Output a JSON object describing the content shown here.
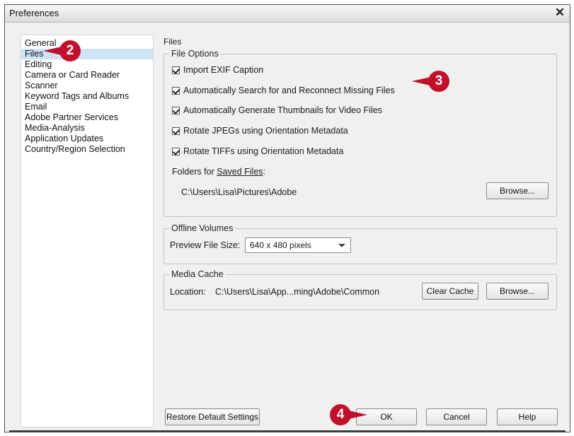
{
  "window": {
    "title": "Preferences",
    "close_glyph": "✕"
  },
  "sidebar": {
    "items": [
      {
        "label": "General"
      },
      {
        "label": "Files",
        "selected": true
      },
      {
        "label": "Editing"
      },
      {
        "label": "Camera or Card Reader"
      },
      {
        "label": "Scanner"
      },
      {
        "label": "Keyword Tags and Albums"
      },
      {
        "label": "Email"
      },
      {
        "label": "Adobe Partner Services"
      },
      {
        "label": "Media-Analysis"
      },
      {
        "label": "Application Updates"
      },
      {
        "label": "Country/Region Selection"
      }
    ]
  },
  "content": {
    "section_title": "Files",
    "file_options": {
      "legend": "File Options",
      "checkboxes": [
        {
          "label": "Import EXIF Caption",
          "checked": true
        },
        {
          "label": "Automatically Search for and Reconnect Missing Files",
          "checked": true
        },
        {
          "label": "Automatically Generate Thumbnails for Video Files",
          "checked": true
        },
        {
          "label": "Rotate JPEGs using Orientation Metadata",
          "checked": true
        },
        {
          "label": "Rotate TIFFs using Orientation Metadata",
          "checked": true
        }
      ],
      "folders_label_prefix": "Folders for ",
      "folders_label_link": "Saved Files",
      "folders_label_suffix": ":",
      "folder_path": "C:\\Users\\Lisa\\Pictures\\Adobe",
      "browse_label": "Browse..."
    },
    "offline_volumes": {
      "legend": "Offline Volumes",
      "preview_label": "Preview File Size:",
      "preview_value": "640 x 480 pixels"
    },
    "media_cache": {
      "legend": "Media Cache",
      "location_label": "Location:",
      "location_value": "C:\\Users\\Lisa\\App...ming\\Adobe\\Common",
      "clear_label": "Clear Cache",
      "browse_label": "Browse..."
    }
  },
  "footer": {
    "restore_label": "Restore Default Settings",
    "ok_label": "OK",
    "cancel_label": "Cancel",
    "help_label": "Help"
  },
  "callouts": {
    "two": "2",
    "three": "3",
    "four": "4",
    "color": "#c0102c"
  }
}
